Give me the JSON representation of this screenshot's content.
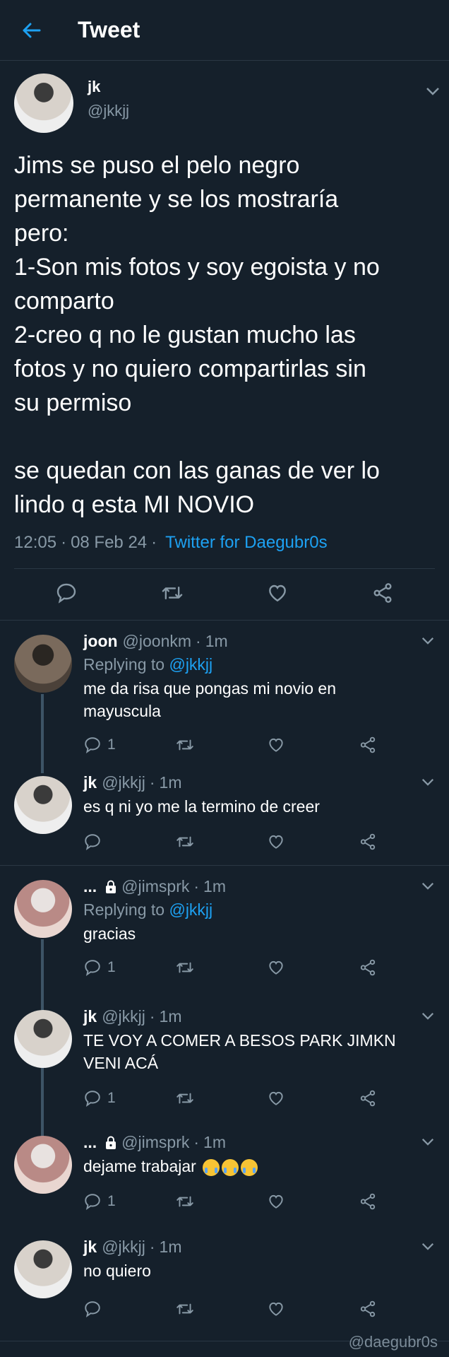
{
  "header": {
    "title": "Tweet"
  },
  "main_tweet": {
    "name": "jk",
    "handle": "@jkkjj",
    "text": "Jims se puso el pelo negro\npermanente y se los mostraría\npero:\n1-Son mis fotos y soy egoista y no\ncomparto\n2-creo q no le gustan mucho las\nfotos y no quiero compartirlas sin\nsu permiso\n\nse quedan con las ganas de ver lo\nlindo q esta MI NOVIO",
    "time": "12:05",
    "date": "08 Feb 24",
    "app": "Twitter for Daegubr0s"
  },
  "replies": [
    {
      "name": "joon",
      "handle": "@joonkm",
      "time": "1m",
      "replying_label": "Replying to",
      "replying_to": "@jkkjj",
      "text": "me da risa que pongas mi novio en\nmayuscula",
      "reply_count": "1"
    },
    {
      "name": "jk",
      "handle": "@jkkjj",
      "time": "1m",
      "text": "es q ni yo me la termino de creer"
    },
    {
      "name": "...",
      "handle": "@jimsprk",
      "time": "1m",
      "replying_label": "Replying to",
      "replying_to": "@jkkjj",
      "text": "gracias",
      "reply_count": "1"
    },
    {
      "name": "jk",
      "handle": "@jkkjj",
      "time": "1m",
      "text": "TE VOY A COMER A BESOS PARK JIMKN\nVENI ACÁ",
      "reply_count": "1"
    },
    {
      "name": "...",
      "handle": "@jimsprk",
      "time": "1m",
      "text": "dejame trabajar",
      "reply_count": "1"
    },
    {
      "name": "jk",
      "handle": "@jkkjj",
      "time": "1m",
      "text": "no quiero"
    }
  ],
  "watermark": "@daegubr0s",
  "colors": {
    "background": "#15202b",
    "accent": "#1da1f2",
    "muted": "#8899a6",
    "thread_line": "#3d5466"
  },
  "icons": [
    "back-arrow-icon",
    "chevron-down-icon",
    "reply-icon",
    "retweet-icon",
    "like-icon",
    "share-icon",
    "lock-icon",
    "crying-emoji-icon"
  ]
}
